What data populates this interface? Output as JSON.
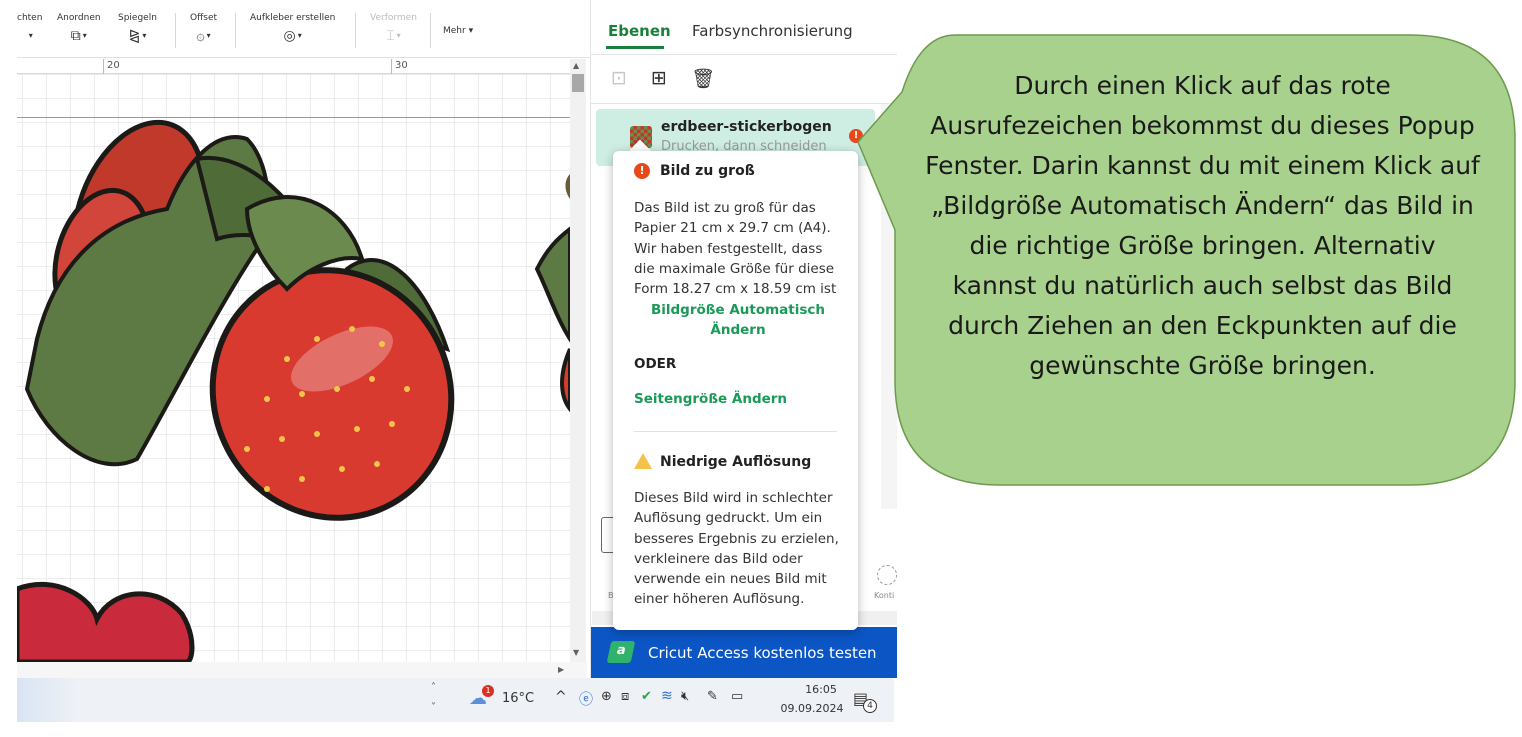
{
  "toolbar": {
    "partial_label": "chten",
    "arrange_label": "Anordnen",
    "mirror_label": "Spiegeln",
    "offset_label": "Offset",
    "sticker_label": "Aufkleber erstellen",
    "warp_label": "Verformen",
    "more_label": "Mehr"
  },
  "ruler": {
    "mark_20": "20",
    "mark_30": "30"
  },
  "panel": {
    "tabs": [
      {
        "label": "Ebenen",
        "active": true
      },
      {
        "label": "Farbsynchronisierung",
        "active": false
      }
    ],
    "layer": {
      "name": "erdbeer-stickerbogen",
      "subtitle": "Drucken, dann schneiden",
      "warning_mark": "!"
    },
    "under_labels": {
      "b": "B",
      "konti": "Konti"
    },
    "access_logo": "a",
    "access_text": "Cricut Access kostenlos testen"
  },
  "popup": {
    "error_mark": "!",
    "error_title": "Bild zu groß",
    "error_body": "Das Bild ist zu groß für das Papier 21 cm x 29.7 cm (A4). Wir haben festgestellt, dass die maximale Größe für diese Form 18.27 cm x 18.59 cm ist",
    "auto_resize_link": "Bildgröße Automatisch Ändern",
    "or_label": "ODER",
    "page_size_link": "Seitengröße Ändern",
    "lowres_title": "Niedrige Auflösung",
    "lowres_body": "Dieses Bild wird in schlechter Auflösung gedruckt. Um ein besseres Ergebnis zu erzielen, verkleinere das Bild oder verwende ein neues Bild mit einer höheren Auflösung."
  },
  "taskbar": {
    "weather_temp": "16°C",
    "weather_badge": "1",
    "time": "16:05",
    "date": "09.09.2024",
    "notification_count": "4"
  },
  "callout": {
    "text": "Durch einen Klick auf das rote Ausrufezeichen bekommst du dieses Popup Fenster. Darin kannst du mit einem Klick auf „Bildgröße Automatisch Ändern“ das Bild in die richtige Größe bringen. Alternativ kannst du natürlich auch selbst das Bild durch Ziehen an den Eckpunkten auf die gewünschte Größe bringen.",
    "fill_color": "#a9d18e",
    "border_color": "#6e9a4e"
  },
  "colors": {
    "accent_green": "#1b7f3c",
    "link_green": "#1a9a58",
    "access_blue": "#0b55c5",
    "error_red": "#e8481a",
    "warning_yellow": "#f4c24a",
    "layer_selected": "#cfeee3"
  }
}
